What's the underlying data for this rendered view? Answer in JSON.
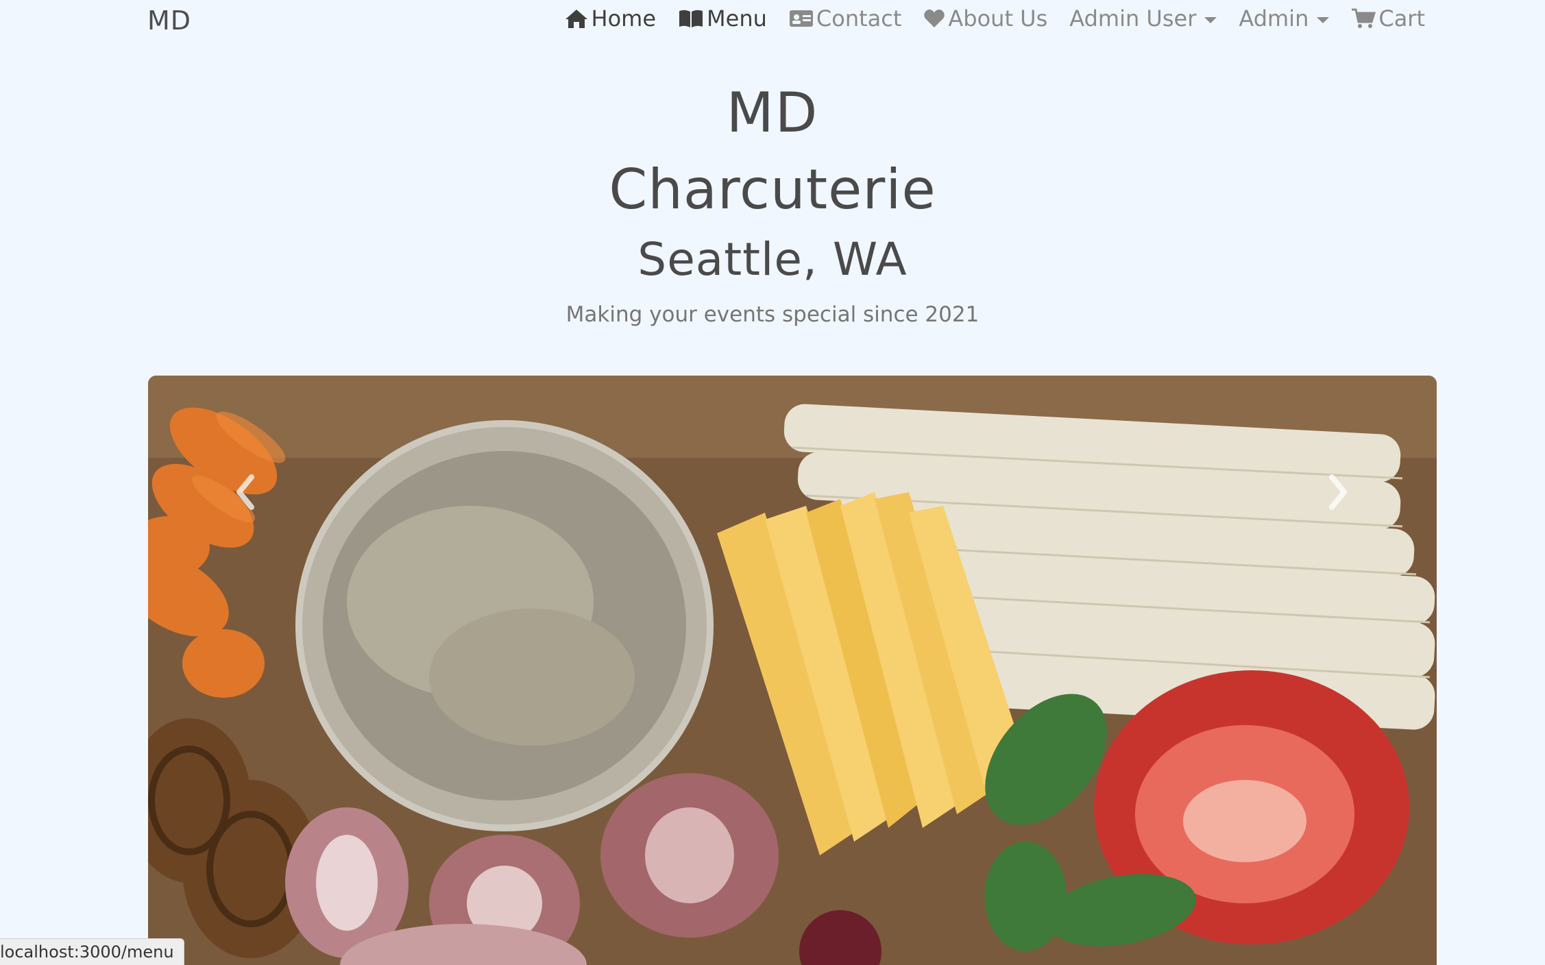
{
  "nav": {
    "brand": "MD",
    "items": [
      {
        "label": "Home",
        "icon": "home-icon"
      },
      {
        "label": "Menu",
        "icon": "book-icon"
      },
      {
        "label": "Contact",
        "icon": "id-card-icon"
      },
      {
        "label": "About Us",
        "icon": "heart-icon"
      },
      {
        "label": "Admin User",
        "icon": "chevron-down-icon"
      },
      {
        "label": "Admin",
        "icon": "chevron-down-icon"
      },
      {
        "label": "Cart",
        "icon": "cart-icon"
      }
    ]
  },
  "hero": {
    "line1": "MD",
    "line2": "Charcuterie",
    "line3": "Seattle, WA",
    "tagline": "Making your events special since 2021"
  },
  "carousel": {
    "prev_icon": "chevron-left-icon",
    "next_icon": "chevron-right-icon"
  },
  "status_bar": {
    "url": "localhost:3000/menu"
  },
  "colors": {
    "background": "#f1f7fe",
    "text_dark": "#4a4a4a",
    "text_muted": "#8a8a8a"
  }
}
